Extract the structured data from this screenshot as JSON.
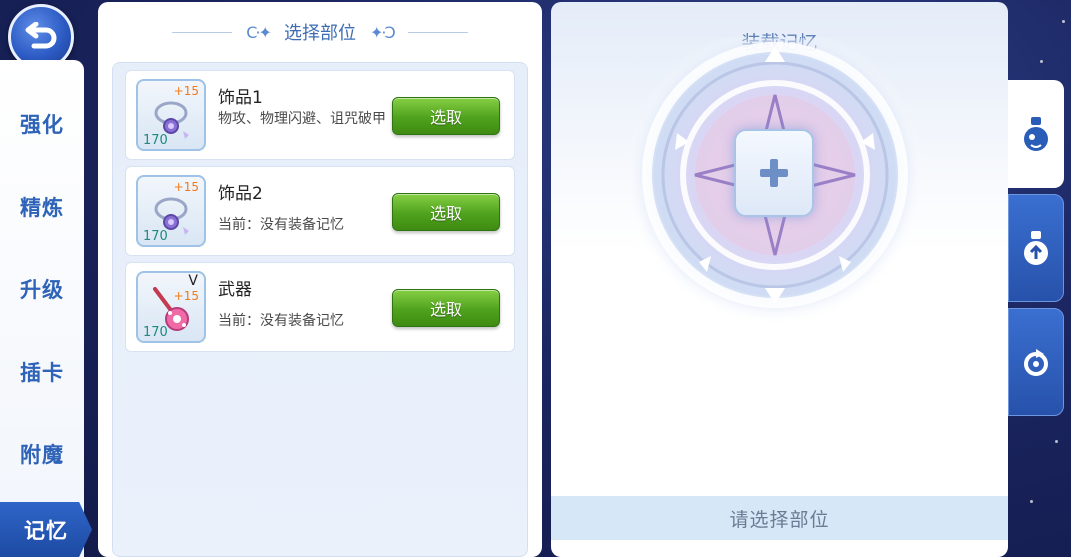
{
  "nav": {
    "items": [
      {
        "label": "强化",
        "active": false
      },
      {
        "label": "精炼",
        "active": false
      },
      {
        "label": "升级",
        "active": false
      },
      {
        "label": "插卡",
        "active": false
      },
      {
        "label": "附魔",
        "active": false
      },
      {
        "label": "记忆",
        "active": true
      }
    ]
  },
  "select_panel": {
    "title": "选择部位",
    "slots": [
      {
        "name": "饰品1",
        "desc": "物攻、物理闪避、诅咒破甲",
        "refine": "+15",
        "level": "170",
        "tag": "",
        "button": "选取"
      },
      {
        "name": "饰品2",
        "desc": "当前：没有装备记忆",
        "refine": "+15",
        "level": "170",
        "tag": "",
        "button": "选取"
      },
      {
        "name": "武器",
        "desc": "当前：没有装备记忆",
        "refine": "+15",
        "level": "170",
        "tag": "V",
        "button": "选取"
      }
    ]
  },
  "memory_panel": {
    "title": "装载记忆",
    "status": "请选择部位"
  },
  "side_tabs": [
    {
      "icon": "potion-blue-icon",
      "active": true
    },
    {
      "icon": "potion-up-icon",
      "active": false
    },
    {
      "icon": "recycle-icon",
      "active": false
    }
  ],
  "colors": {
    "nav_text": "#2e63b8",
    "active_nav_bg": "#2f66c8",
    "button_green": "#4fa21d",
    "refine_orange": "#f07a1b",
    "level_teal": "#1f8a7e"
  }
}
